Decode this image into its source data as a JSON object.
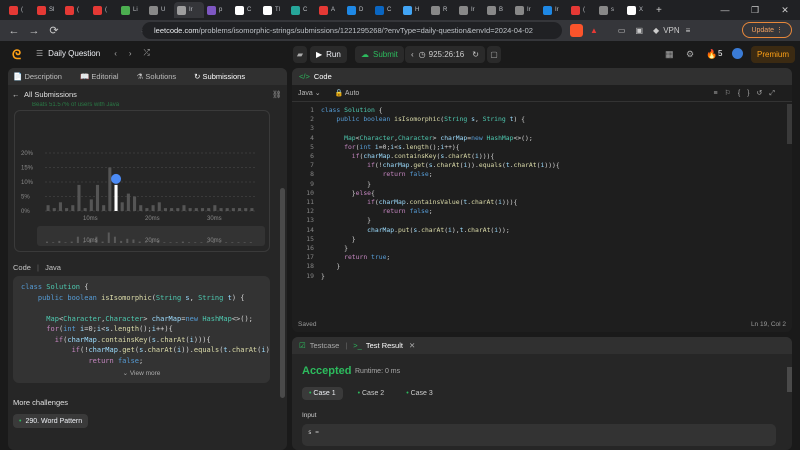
{
  "browser": {
    "tabs": [
      {
        "label": "(",
        "color": "#e53935"
      },
      {
        "label": "Sl",
        "color": "#e53935"
      },
      {
        "label": "(",
        "color": "#e53935"
      },
      {
        "label": "(",
        "color": "#e53935"
      },
      {
        "label": "Li",
        "color": "#4caf50"
      },
      {
        "label": "U",
        "color": "#888888"
      },
      {
        "label": "Ir",
        "color": "#9e9e9e"
      },
      {
        "label": "p",
        "color": "#7e57c2"
      },
      {
        "label": "C",
        "color": "#ffffff"
      },
      {
        "label": "Tl",
        "color": "#ffffff"
      },
      {
        "label": "C",
        "color": "#26a69a"
      },
      {
        "label": "A",
        "color": "#e53935"
      },
      {
        "label": "D",
        "color": "#1e88e5"
      },
      {
        "label": "C",
        "color": "#0a66c2"
      },
      {
        "label": "H",
        "color": "#42a5f5"
      },
      {
        "label": "R",
        "color": "#888888"
      },
      {
        "label": "Ir",
        "color": "#888888"
      },
      {
        "label": "B",
        "color": "#888888"
      },
      {
        "label": "Ir",
        "color": "#888888"
      },
      {
        "label": "Ir",
        "color": "#1e88e5"
      },
      {
        "label": "(",
        "color": "#e53935"
      },
      {
        "label": "s",
        "color": "#888888"
      },
      {
        "label": "X",
        "color": "#ffffff"
      }
    ],
    "active_tab_index": 6,
    "url_host": "leetcode.com",
    "url_path": "/problems/isomorphic-strings/submissions/1221295268/?envType=daily-question&envId=2024-04-02",
    "vpn_label": "VPN",
    "update_label": "Update"
  },
  "lc": {
    "daily_question": "Daily Question",
    "run_label": "Run",
    "submit_label": "Submit",
    "timer": "925:26:16",
    "streak": "5",
    "premium_label": "Premium"
  },
  "left": {
    "tabs": [
      "Description",
      "Editorial",
      "Solutions",
      "Submissions"
    ],
    "all_submissions": "All Submissions",
    "beats_text": "Beats 51.57% of users with Java",
    "chart_data": {
      "type": "bar",
      "x_ticks": [
        "10ms",
        "20ms",
        "30ms"
      ],
      "y_ticks": [
        "20%",
        "15%",
        "10%",
        "5%",
        "0%"
      ],
      "ylim": [
        0,
        20
      ],
      "values": [
        2,
        1,
        3,
        1,
        2,
        9,
        1,
        4,
        9,
        2,
        15,
        9,
        3,
        6,
        5,
        2,
        1,
        2,
        3,
        1,
        1,
        1,
        2,
        1,
        1,
        1,
        1,
        2,
        1,
        1,
        1,
        1,
        1,
        1
      ],
      "highlight_index": 11
    },
    "code_label": "Code",
    "lang_label": "Java",
    "view_more": "View more",
    "more_challenges": "More challenges",
    "challenge": "290. Word Pattern"
  },
  "right": {
    "code_title": "Code",
    "lang": "Java",
    "auto": "Auto",
    "saved": "Saved",
    "position": "Ln 19, Col 2",
    "testcase_tab": "Testcase",
    "result_tab": "Test Result",
    "accepted": "Accepted",
    "runtime": "Runtime: 0 ms",
    "cases": [
      "Case 1",
      "Case 2",
      "Case 3"
    ],
    "input_label": "Input",
    "input_value": "s ="
  }
}
